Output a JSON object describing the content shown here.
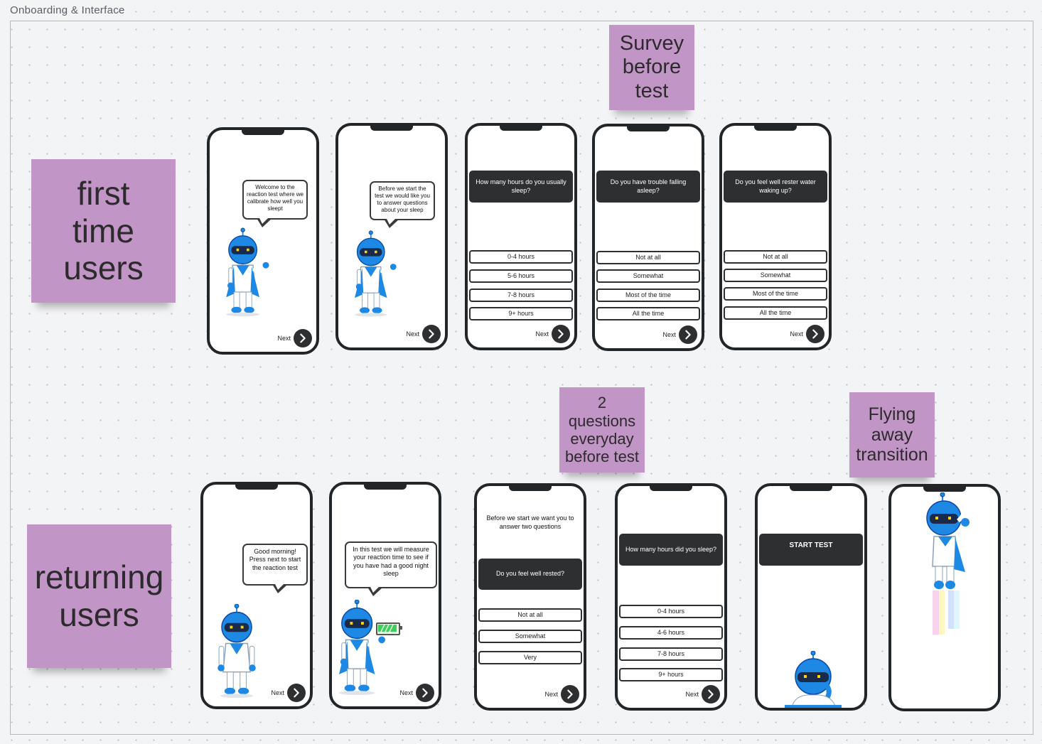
{
  "board": {
    "frame_title": "Onboarding & Interface"
  },
  "stickies": {
    "first_time": "first\ntime\nusers",
    "returning": "returning\nusers",
    "survey": "Survey\nbefore\ntest",
    "two_questions": "2\nquestions\neveryday\nbefore test",
    "flying": "Flying\naway\ntransition"
  },
  "common": {
    "next_label": "Next"
  },
  "first_time_screens": {
    "s1": {
      "bubble": "Welcome to the reaction test where we calibrate how well you sleept"
    },
    "s2": {
      "bubble": "Before we start the test we would like you to answer questions about your sleep"
    },
    "s3": {
      "question": "How many hours do you usually sleep?",
      "options": [
        "0-4 hours",
        "5-6 hours",
        "7-8 hours",
        "9+ hours"
      ]
    },
    "s4": {
      "question": "Do you have trouble falling asleep?",
      "options": [
        "Not at all",
        "Somewhat",
        "Most of the time",
        "All the time"
      ]
    },
    "s5": {
      "question": "Do you feel well rester water waking up?",
      "options": [
        "Not at all",
        "Somewhat",
        "Most of the time",
        "All the time"
      ]
    }
  },
  "returning_screens": {
    "r1": {
      "bubble": "Good morning! Press next to start the reaction test"
    },
    "r2": {
      "bubble": "In this test we will measure your reaction time to see if you have had a good night sleep"
    },
    "r3": {
      "intro": "Before we start we want you to answer two questions",
      "question": "Do you feel well rested?",
      "options": [
        "Not at all",
        "Somewhat",
        "Very"
      ]
    },
    "r4": {
      "question": "How many hours did you sleep?",
      "options": [
        "0-4 hours",
        "4-6 hours",
        "7-8 hours",
        "9+ hours"
      ]
    },
    "r5": {
      "button": "START TEST"
    }
  },
  "colors": {
    "sticky": "#c195c5",
    "robot_blue": "#1e88e5",
    "robot_dark": "#1a2a4a",
    "dark_panel": "#2d2f31"
  },
  "icons": {
    "next": "chevron-right-icon",
    "robot": "robot-mascot",
    "battery": "battery-full-icon"
  }
}
